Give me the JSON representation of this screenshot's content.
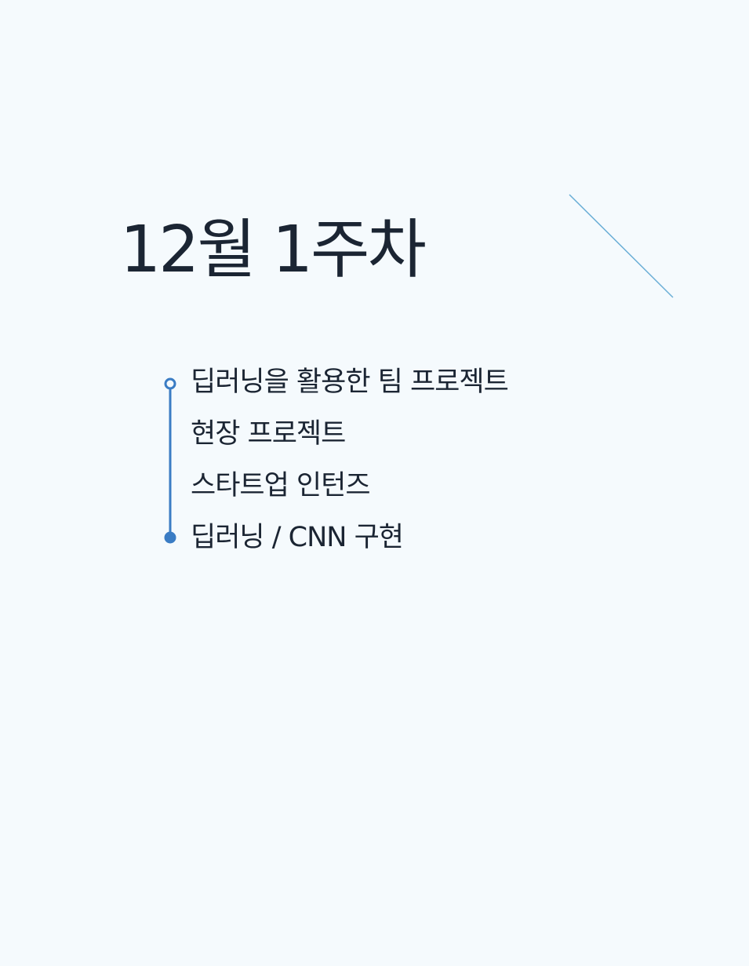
{
  "title": "12월 1주차",
  "items": [
    "딥러닝을 활용한 팀 프로젝트",
    "현장 프로젝트",
    "스타트업 인턴즈",
    "딥러닝 / CNN 구현"
  ],
  "colors": {
    "background": "#f5fafd",
    "text": "#1b2533",
    "accent": "#3a7cc4",
    "diagonal_line": "#6aaed6"
  }
}
